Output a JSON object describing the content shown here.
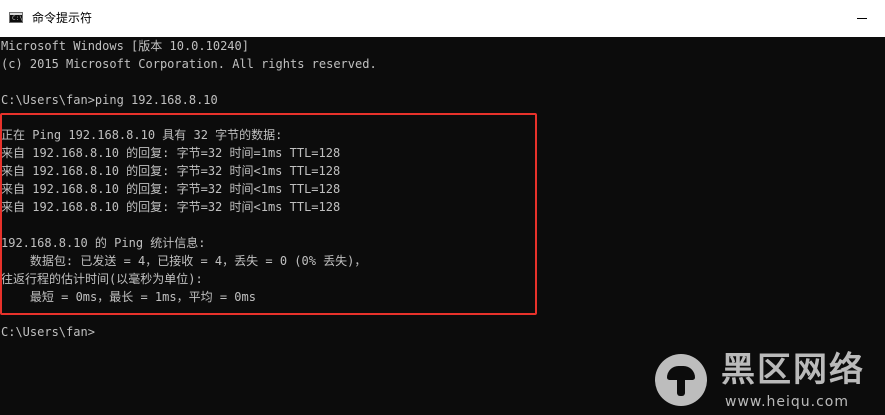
{
  "window": {
    "title": "命令提示符",
    "icon": "cmd-console-icon",
    "icon_glyph": "C:\\"
  },
  "console": {
    "background_color": "#0c0c0c",
    "text_color": "#c0c0c0",
    "highlight_color": "#e8322b",
    "lines": [
      "Microsoft Windows [版本 10.0.10240]",
      "(c) 2015 Microsoft Corporation. All rights reserved.",
      "",
      "C:\\Users\\fan>ping 192.168.8.10",
      "",
      "正在 Ping 192.168.8.10 具有 32 字节的数据:",
      "来自 192.168.8.10 的回复: 字节=32 时间=1ms TTL=128",
      "来自 192.168.8.10 的回复: 字节=32 时间<1ms TTL=128",
      "来自 192.168.8.10 的回复: 字节=32 时间<1ms TTL=128",
      "来自 192.168.8.10 的回复: 字节=32 时间<1ms TTL=128",
      "",
      "192.168.8.10 的 Ping 统计信息:",
      "    数据包: 已发送 = 4，已接收 = 4，丢失 = 0 (0% 丢失)，",
      "往返行程的估计时间(以毫秒为单位):",
      "    最短 = 0ms，最长 = 1ms，平均 = 0ms",
      "",
      "C:\\Users\\fan>"
    ]
  },
  "watermark": {
    "title": "黑区网络",
    "url": "www.heiqu.com",
    "icon": "mushroom-logo-icon"
  }
}
